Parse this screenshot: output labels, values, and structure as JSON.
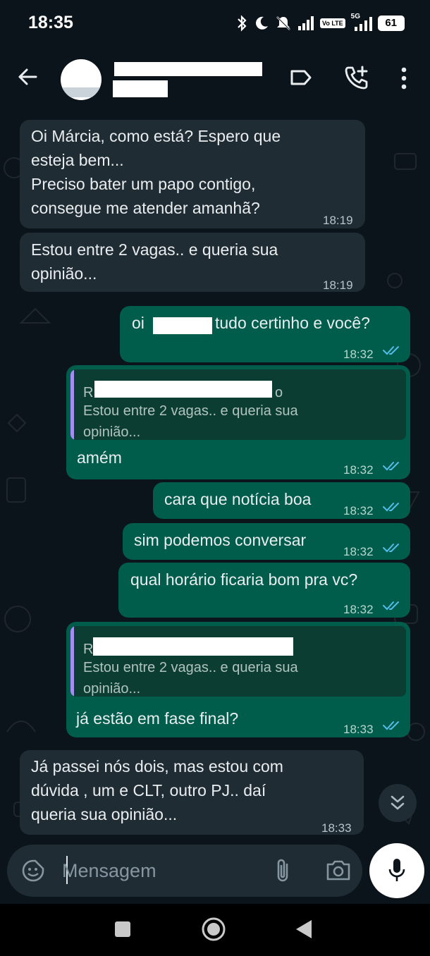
{
  "status_bar": {
    "time": "18:35",
    "icons": [
      "bluetooth-icon",
      "moon-icon",
      "mute-icon",
      "signal-icon",
      "volte-icon",
      "5g-signal-icon",
      "battery-icon"
    ],
    "volte_label": "Vo LTE",
    "network_label": "5G",
    "battery_level": "61"
  },
  "header": {
    "back_icon": "arrow-left-icon",
    "label_icon": "label-icon",
    "add_call_icon": "add-call-icon",
    "menu_icon": "more-vert-icon"
  },
  "messages": [
    {
      "direction": "in",
      "text": "Oi Márcia, como está? Espero que\nesteja bem...\nPreciso bater um papo contigo,\nconsegue me atender amanhã?",
      "time": "18:19"
    },
    {
      "direction": "in",
      "text": "Estou entre 2 vagas.. e queria sua\nopinião...",
      "time": "18:19"
    },
    {
      "direction": "out",
      "text_before": "oi",
      "text_after": "tudo certinho e você?",
      "time": "18:32",
      "read": true
    },
    {
      "direction": "out",
      "quote_initial": "R",
      "quote_tail": "o",
      "quote_text": "Estou entre 2 vagas.. e queria sua\nopinião...",
      "text": "amém",
      "time": "18:32",
      "read": true
    },
    {
      "direction": "out",
      "text": "cara que notícia boa",
      "time": "18:32",
      "read": true
    },
    {
      "direction": "out",
      "text": "sim podemos conversar",
      "time": "18:32",
      "read": true
    },
    {
      "direction": "out",
      "text": "qual horário ficaria bom pra vc?",
      "time": "18:32",
      "read": true
    },
    {
      "direction": "out",
      "quote_initial": "R",
      "quote_text": "Estou entre 2 vagas.. e queria sua\nopinião...",
      "text": "já estão em fase final?",
      "time": "18:33",
      "read": true
    },
    {
      "direction": "in",
      "text": "Já passei nós dois, mas estou com\ndúvida , um e CLT, outro PJ.. daí\nqueria sua opinião...",
      "time": "18:33"
    }
  ],
  "composer": {
    "placeholder": "Mensagem",
    "emoji_icon": "sticker-emoji-icon",
    "attach_icon": "paperclip-icon",
    "camera_icon": "camera-icon",
    "mic_icon": "microphone-icon",
    "scroll_icon": "double-chevron-down-icon"
  },
  "nav_bar": {
    "icons": [
      "recent-apps-square-icon",
      "home-circle-icon",
      "back-triangle-icon"
    ]
  },
  "colors": {
    "background": "#0b141a",
    "incoming_bubble": "#202c33",
    "outgoing_bubble": "#005c4b",
    "read_ticks": "#53bdeb",
    "quote_bar": "#a68bf0"
  }
}
